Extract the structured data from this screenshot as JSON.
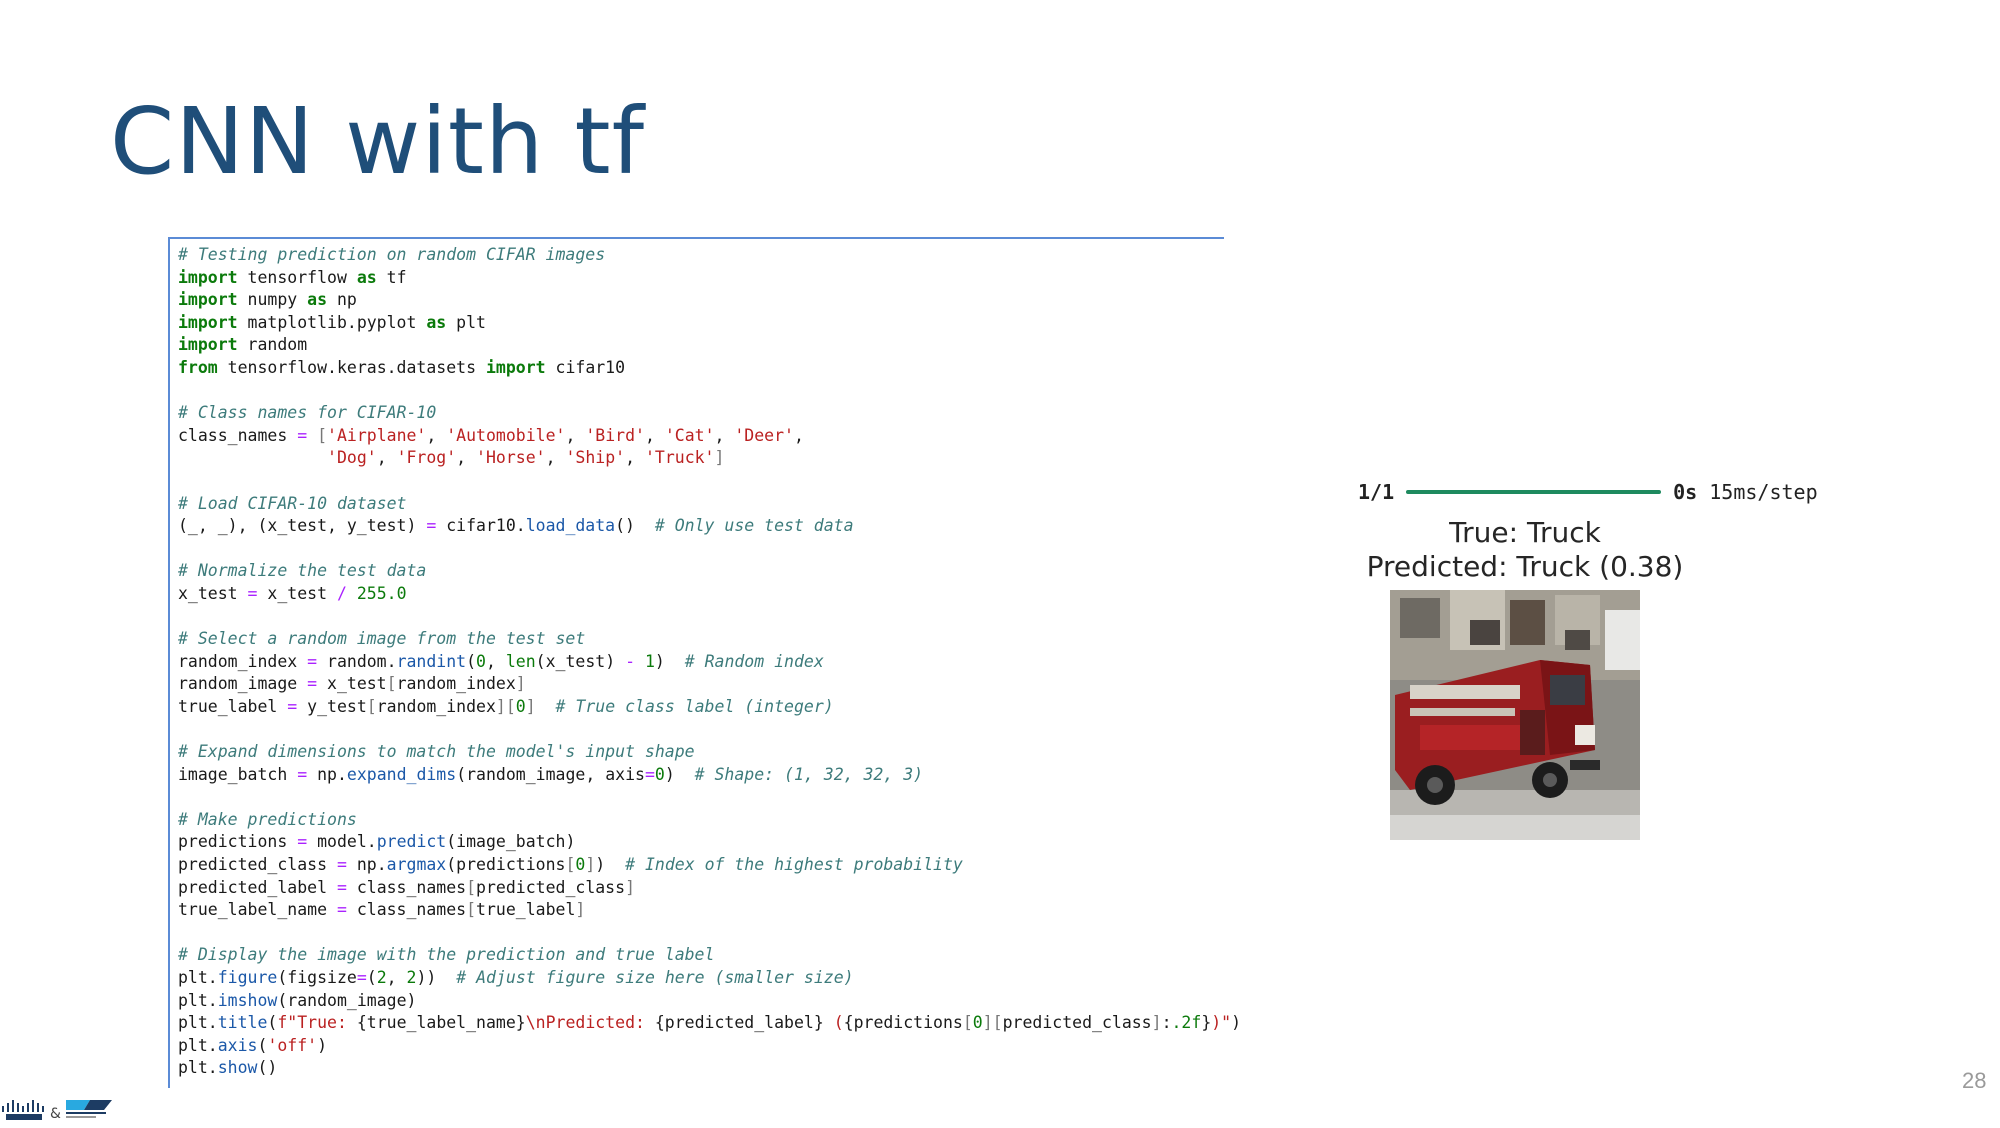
{
  "slide": {
    "title": "CNN with tf",
    "page_number": "28"
  },
  "code": {
    "lines": [
      [
        {
          "t": "cm",
          "v": "# Testing prediction on random CIFAR images"
        }
      ],
      [
        {
          "t": "kw",
          "v": "import"
        },
        {
          "t": "",
          "v": " tensorflow "
        },
        {
          "t": "kw",
          "v": "as"
        },
        {
          "t": "",
          "v": " tf"
        }
      ],
      [
        {
          "t": "kw",
          "v": "import"
        },
        {
          "t": "",
          "v": " numpy "
        },
        {
          "t": "kw",
          "v": "as"
        },
        {
          "t": "",
          "v": " np"
        }
      ],
      [
        {
          "t": "kw",
          "v": "import"
        },
        {
          "t": "",
          "v": " matplotlib.pyplot "
        },
        {
          "t": "kw",
          "v": "as"
        },
        {
          "t": "",
          "v": " plt"
        }
      ],
      [
        {
          "t": "kw",
          "v": "import"
        },
        {
          "t": "",
          "v": " random"
        }
      ],
      [
        {
          "t": "kw",
          "v": "from"
        },
        {
          "t": "",
          "v": " tensorflow.keras.datasets "
        },
        {
          "t": "kw",
          "v": "import"
        },
        {
          "t": "",
          "v": " cifar10"
        }
      ],
      [],
      [
        {
          "t": "cm",
          "v": "# Class names for CIFAR-10"
        }
      ],
      [
        {
          "t": "",
          "v": "class_names "
        },
        {
          "t": "op",
          "v": "="
        },
        {
          "t": "",
          "v": " "
        },
        {
          "t": "br",
          "v": "["
        },
        {
          "t": "st",
          "v": "'Airplane'"
        },
        {
          "t": "",
          "v": ", "
        },
        {
          "t": "st",
          "v": "'Automobile'"
        },
        {
          "t": "",
          "v": ", "
        },
        {
          "t": "st",
          "v": "'Bird'"
        },
        {
          "t": "",
          "v": ", "
        },
        {
          "t": "st",
          "v": "'Cat'"
        },
        {
          "t": "",
          "v": ", "
        },
        {
          "t": "st",
          "v": "'Deer'"
        },
        {
          "t": "",
          "v": ","
        }
      ],
      [
        {
          "t": "",
          "v": "               "
        },
        {
          "t": "st",
          "v": "'Dog'"
        },
        {
          "t": "",
          "v": ", "
        },
        {
          "t": "st",
          "v": "'Frog'"
        },
        {
          "t": "",
          "v": ", "
        },
        {
          "t": "st",
          "v": "'Horse'"
        },
        {
          "t": "",
          "v": ", "
        },
        {
          "t": "st",
          "v": "'Ship'"
        },
        {
          "t": "",
          "v": ", "
        },
        {
          "t": "st",
          "v": "'Truck'"
        },
        {
          "t": "br",
          "v": "]"
        }
      ],
      [],
      [
        {
          "t": "cm",
          "v": "# Load CIFAR-10 dataset"
        }
      ],
      [
        {
          "t": "",
          "v": "(_, _), (x_test, y_test) "
        },
        {
          "t": "op",
          "v": "="
        },
        {
          "t": "",
          "v": " cifar10."
        },
        {
          "t": "fn",
          "v": "load_data"
        },
        {
          "t": "",
          "v": "()  "
        },
        {
          "t": "cm",
          "v": "# Only use test data"
        }
      ],
      [],
      [
        {
          "t": "cm",
          "v": "# Normalize the test data"
        }
      ],
      [
        {
          "t": "",
          "v": "x_test "
        },
        {
          "t": "op",
          "v": "="
        },
        {
          "t": "",
          "v": " x_test "
        },
        {
          "t": "op",
          "v": "/"
        },
        {
          "t": "",
          "v": " "
        },
        {
          "t": "nm",
          "v": "255.0"
        }
      ],
      [],
      [
        {
          "t": "cm",
          "v": "# Select a random image from the test set"
        }
      ],
      [
        {
          "t": "",
          "v": "random_index "
        },
        {
          "t": "op",
          "v": "="
        },
        {
          "t": "",
          "v": " random."
        },
        {
          "t": "fn",
          "v": "randint"
        },
        {
          "t": "",
          "v": "("
        },
        {
          "t": "nm",
          "v": "0"
        },
        {
          "t": "",
          "v": ", "
        },
        {
          "t": "nm",
          "v": "len"
        },
        {
          "t": "",
          "v": "(x_test) "
        },
        {
          "t": "op",
          "v": "-"
        },
        {
          "t": "",
          "v": " "
        },
        {
          "t": "nm",
          "v": "1"
        },
        {
          "t": "",
          "v": ")  "
        },
        {
          "t": "cm",
          "v": "# Random index"
        }
      ],
      [
        {
          "t": "",
          "v": "random_image "
        },
        {
          "t": "op",
          "v": "="
        },
        {
          "t": "",
          "v": " x_test"
        },
        {
          "t": "br",
          "v": "["
        },
        {
          "t": "",
          "v": "random_index"
        },
        {
          "t": "br",
          "v": "]"
        }
      ],
      [
        {
          "t": "",
          "v": "true_label "
        },
        {
          "t": "op",
          "v": "="
        },
        {
          "t": "",
          "v": " y_test"
        },
        {
          "t": "br",
          "v": "["
        },
        {
          "t": "",
          "v": "random_index"
        },
        {
          "t": "br",
          "v": "]["
        },
        {
          "t": "nm",
          "v": "0"
        },
        {
          "t": "br",
          "v": "]"
        },
        {
          "t": "",
          "v": "  "
        },
        {
          "t": "cm",
          "v": "# True class label (integer)"
        }
      ],
      [],
      [
        {
          "t": "cm",
          "v": "# Expand dimensions to match the model's input shape"
        }
      ],
      [
        {
          "t": "",
          "v": "image_batch "
        },
        {
          "t": "op",
          "v": "="
        },
        {
          "t": "",
          "v": " np."
        },
        {
          "t": "fn",
          "v": "expand_dims"
        },
        {
          "t": "",
          "v": "(random_image, axis"
        },
        {
          "t": "op",
          "v": "="
        },
        {
          "t": "nm",
          "v": "0"
        },
        {
          "t": "",
          "v": ")  "
        },
        {
          "t": "cm",
          "v": "# Shape: (1, 32, 32, 3)"
        }
      ],
      [],
      [
        {
          "t": "cm",
          "v": "# Make predictions"
        }
      ],
      [
        {
          "t": "",
          "v": "predictions "
        },
        {
          "t": "op",
          "v": "="
        },
        {
          "t": "",
          "v": " model."
        },
        {
          "t": "fn",
          "v": "predict"
        },
        {
          "t": "",
          "v": "(image_batch)"
        }
      ],
      [
        {
          "t": "",
          "v": "predicted_class "
        },
        {
          "t": "op",
          "v": "="
        },
        {
          "t": "",
          "v": " np."
        },
        {
          "t": "fn",
          "v": "argmax"
        },
        {
          "t": "",
          "v": "(predictions"
        },
        {
          "t": "br",
          "v": "["
        },
        {
          "t": "nm",
          "v": "0"
        },
        {
          "t": "br",
          "v": "]"
        },
        {
          "t": "",
          "v": ")  "
        },
        {
          "t": "cm",
          "v": "# Index of the highest probability"
        }
      ],
      [
        {
          "t": "",
          "v": "predicted_label "
        },
        {
          "t": "op",
          "v": "="
        },
        {
          "t": "",
          "v": " class_names"
        },
        {
          "t": "br",
          "v": "["
        },
        {
          "t": "",
          "v": "predicted_class"
        },
        {
          "t": "br",
          "v": "]"
        }
      ],
      [
        {
          "t": "",
          "v": "true_label_name "
        },
        {
          "t": "op",
          "v": "="
        },
        {
          "t": "",
          "v": " class_names"
        },
        {
          "t": "br",
          "v": "["
        },
        {
          "t": "",
          "v": "true_label"
        },
        {
          "t": "br",
          "v": "]"
        }
      ],
      [],
      [
        {
          "t": "cm",
          "v": "# Display the image with the prediction and true label"
        }
      ],
      [
        {
          "t": "",
          "v": "plt."
        },
        {
          "t": "fn",
          "v": "figure"
        },
        {
          "t": "",
          "v": "(figsize"
        },
        {
          "t": "op",
          "v": "="
        },
        {
          "t": "",
          "v": "("
        },
        {
          "t": "nm",
          "v": "2"
        },
        {
          "t": "",
          "v": ", "
        },
        {
          "t": "nm",
          "v": "2"
        },
        {
          "t": "",
          "v": "))  "
        },
        {
          "t": "cm",
          "v": "# Adjust figure size here (smaller size)"
        }
      ],
      [
        {
          "t": "",
          "v": "plt."
        },
        {
          "t": "fn",
          "v": "imshow"
        },
        {
          "t": "",
          "v": "(random_image)"
        }
      ],
      [
        {
          "t": "",
          "v": "plt."
        },
        {
          "t": "fn",
          "v": "title"
        },
        {
          "t": "",
          "v": "("
        },
        {
          "t": "st",
          "v": "f\"True: "
        },
        {
          "t": "",
          "v": "{true_label_name}"
        },
        {
          "t": "st",
          "v": "\\nPredicted: "
        },
        {
          "t": "",
          "v": "{predicted_label}"
        },
        {
          "t": "st",
          "v": " ("
        },
        {
          "t": "",
          "v": "{predictions"
        },
        {
          "t": "br",
          "v": "["
        },
        {
          "t": "nm",
          "v": "0"
        },
        {
          "t": "br",
          "v": "]["
        },
        {
          "t": "",
          "v": "predicted_class"
        },
        {
          "t": "br",
          "v": "]"
        },
        {
          "t": "",
          "v": ":"
        },
        {
          "t": "nm",
          "v": ".2f"
        },
        {
          "t": "",
          "v": "}"
        },
        {
          "t": "st",
          "v": ")\""
        },
        {
          "t": "",
          "v": ")"
        }
      ],
      [
        {
          "t": "",
          "v": "plt."
        },
        {
          "t": "fn",
          "v": "axis"
        },
        {
          "t": "",
          "v": "("
        },
        {
          "t": "st",
          "v": "'off'"
        },
        {
          "t": "",
          "v": ")"
        }
      ],
      [
        {
          "t": "",
          "v": "plt."
        },
        {
          "t": "fn",
          "v": "show"
        },
        {
          "t": "",
          "v": "()"
        }
      ]
    ]
  },
  "output": {
    "progress_step": "1/1",
    "progress_fraction": 1.0,
    "progress_time": "0s",
    "progress_rate": "15ms/step",
    "figure_title_line1": "True: Truck",
    "figure_title_line2": "Predicted: Truck (0.38)"
  },
  "colors": {
    "title": "#1f4e79",
    "cell_border": "#5b8bd6",
    "progress_bar": "#1e8a5f"
  }
}
